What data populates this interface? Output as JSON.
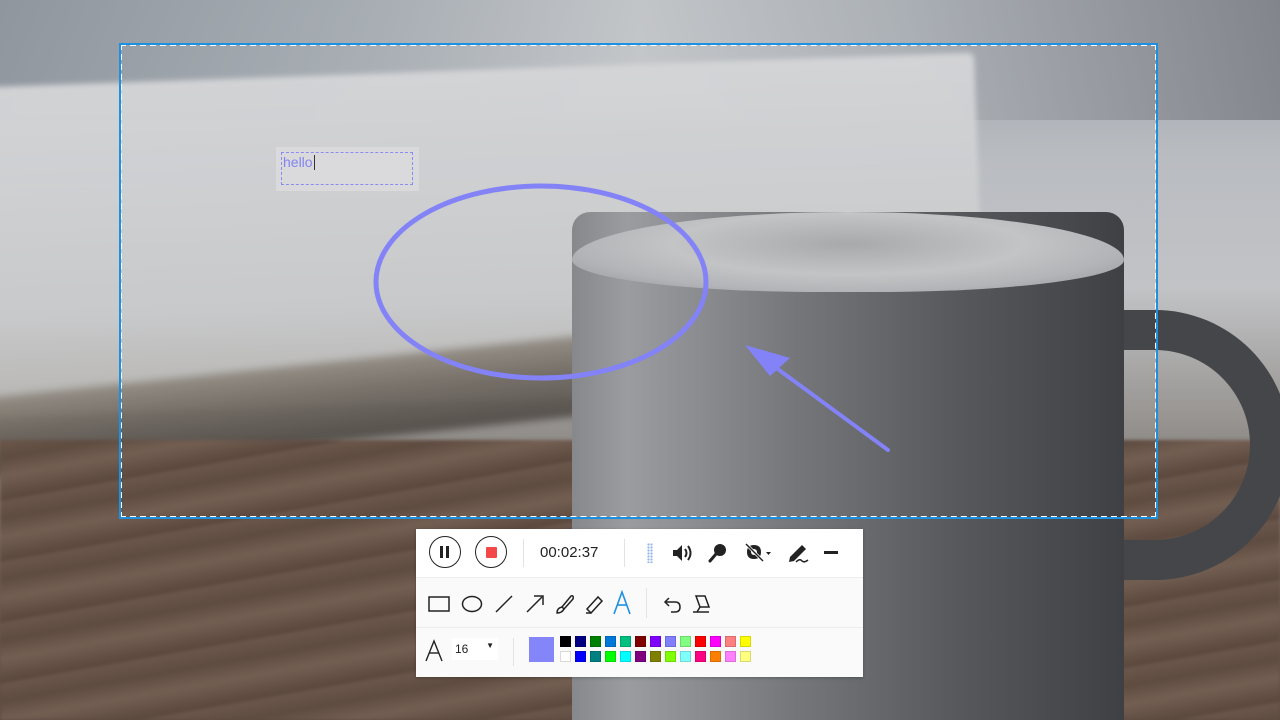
{
  "annotation": {
    "text": "hello",
    "color": "#8383f2"
  },
  "toolbar": {
    "timer": "00:02:37",
    "font_size": "16",
    "selected_color": "#8585fa",
    "icons": {
      "pause": "pause-icon",
      "stop": "stop-icon",
      "speaker": "speaker-icon",
      "microphone": "microphone-icon",
      "camera_off": "camera-off-icon",
      "pen": "pen-icon",
      "minimize": "minimize-icon",
      "rectangle": "rectangle-icon",
      "ellipse": "ellipse-icon",
      "line": "line-icon",
      "arrow": "arrow-icon",
      "brush": "brush-icon",
      "highlighter": "highlighter-icon",
      "text": "text-icon",
      "undo": "undo-icon",
      "eraser": "eraser-icon",
      "font": "font-icon"
    },
    "palette_top": [
      "#000000",
      "#000080",
      "#008000",
      "#0078d7",
      "#00c080",
      "#800000",
      "#8000ff",
      "#8080ff",
      "#80ff80",
      "#ff0000",
      "#ff00ff",
      "#ff8080",
      "#ffff00"
    ],
    "palette_bottom": [
      "#ffffff",
      "#0000ff",
      "#008080",
      "#00ff00",
      "#00ffff",
      "#800080",
      "#808000",
      "#80ff00",
      "#80ffff",
      "#ff0080",
      "#ff8000",
      "#ff80ff",
      "#ffff80"
    ]
  },
  "frame_color": "#1e90e0",
  "active_tool_color": "#1e90e0"
}
